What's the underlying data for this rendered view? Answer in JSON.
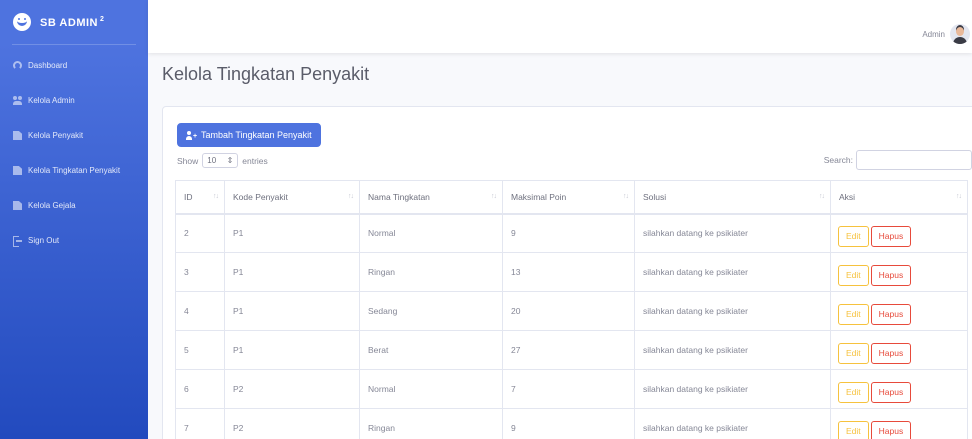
{
  "brand": {
    "name": "SB ADMIN",
    "sup": "2"
  },
  "sidebar": {
    "items": [
      {
        "label": "Dashboard",
        "icon": "dashboard-icon"
      },
      {
        "label": "Kelola Admin",
        "icon": "users-icon"
      },
      {
        "label": "Kelola Penyakit",
        "icon": "file-icon"
      },
      {
        "label": "Kelola Tingkatan Penyakit",
        "icon": "file-icon"
      },
      {
        "label": "Kelola Gejala",
        "icon": "file-icon"
      },
      {
        "label": "Sign Out",
        "icon": "sign-out-icon"
      }
    ]
  },
  "topbar": {
    "user_name": "Admin"
  },
  "page": {
    "title": "Kelola Tingkatan Penyakit"
  },
  "toolbar": {
    "add_label": "Tambah Tingkatan Penyakit"
  },
  "table_controls": {
    "show_label": "Show",
    "entries_value": "10",
    "entries_label": "entries",
    "search_label": "Search:",
    "search_value": ""
  },
  "table": {
    "columns": [
      "ID",
      "Kode Penyakit",
      "Nama Tingkatan",
      "Maksimal Poin",
      "Solusi",
      "Aksi"
    ],
    "rows": [
      {
        "id": "2",
        "kode": "P1",
        "nama": "Normal",
        "poin": "9",
        "solusi": "silahkan datang ke psikiater"
      },
      {
        "id": "3",
        "kode": "P1",
        "nama": "Ringan",
        "poin": "13",
        "solusi": "silahkan datang ke psikiater"
      },
      {
        "id": "4",
        "kode": "P1",
        "nama": "Sedang",
        "poin": "20",
        "solusi": "silahkan datang ke psikiater"
      },
      {
        "id": "5",
        "kode": "P1",
        "nama": "Berat",
        "poin": "27",
        "solusi": "silahkan datang ke psikiater"
      },
      {
        "id": "6",
        "kode": "P2",
        "nama": "Normal",
        "poin": "7",
        "solusi": "silahkan datang ke psikiater"
      },
      {
        "id": "7",
        "kode": "P2",
        "nama": "Ringan",
        "poin": "9",
        "solusi": "silahkan datang ke psikiater"
      }
    ],
    "edit_label": "Edit",
    "delete_label": "Hapus"
  },
  "colors": {
    "primary": "#4e73df",
    "warning": "#f6c23e",
    "danger": "#e74a3b"
  }
}
